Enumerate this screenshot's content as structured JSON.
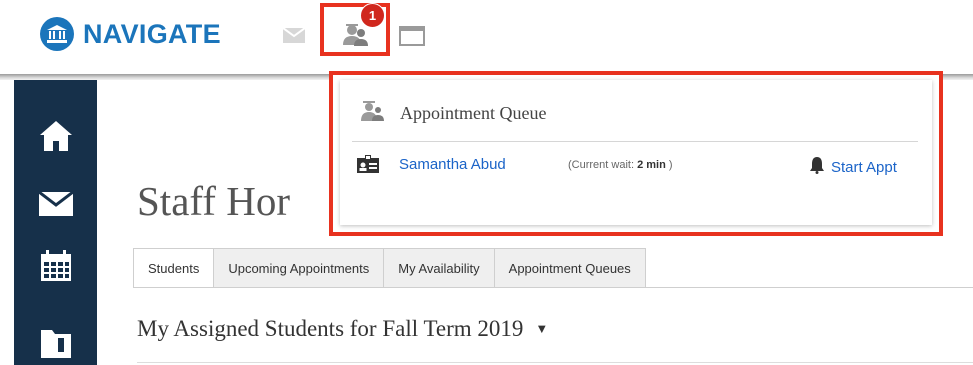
{
  "brand": {
    "name": "NAVIGATE",
    "color": "#1b75bb"
  },
  "topbar": {
    "icons": [
      "mail-icon",
      "staff-queue-icon",
      "window-icon"
    ],
    "notification_count": "1"
  },
  "rail": {
    "items": [
      "home-icon",
      "mail-icon",
      "calendar-icon",
      "folder-icon"
    ]
  },
  "page": {
    "title": "Staff Hor"
  },
  "tabs": [
    {
      "label": "Students",
      "active": true
    },
    {
      "label": "Upcoming Appointments",
      "active": false
    },
    {
      "label": "My Availability",
      "active": false
    },
    {
      "label": "Appointment Queues",
      "active": false
    }
  ],
  "section": {
    "title": "My Assigned Students for Fall Term 2019",
    "caret": "▼"
  },
  "queue_dropdown": {
    "heading": "Appointment Queue",
    "entries": [
      {
        "name": "Samantha Abud",
        "wait_prefix": "(Current wait: ",
        "wait_value": "2 min",
        "wait_suffix": " )",
        "action": "Start Appt"
      }
    ]
  },
  "colors": {
    "highlight": "#e8321f",
    "rail": "#16304a",
    "link": "#1b64c8",
    "badge": "#d0271d"
  }
}
